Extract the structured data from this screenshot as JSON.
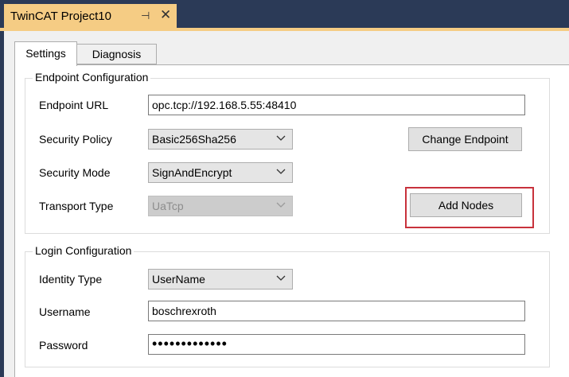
{
  "document_tab": {
    "title": "TwinCAT Project10",
    "pin_glyph": "⊣",
    "close_glyph": "✕"
  },
  "tabs": [
    {
      "label": "Settings",
      "active": true
    },
    {
      "label": "Diagnosis",
      "active": false
    }
  ],
  "endpoint": {
    "legend": "Endpoint Configuration",
    "url_label": "Endpoint URL",
    "url_value": "opc.tcp://192.168.5.55:48410",
    "policy_label": "Security Policy",
    "policy_value": "Basic256Sha256",
    "mode_label": "Security Mode",
    "mode_value": "SignAndEncrypt",
    "transport_label": "Transport Type",
    "transport_value": "UaTcp",
    "change_button": "Change Endpoint",
    "add_nodes_button": "Add Nodes"
  },
  "login": {
    "legend": "Login Configuration",
    "identity_label": "Identity Type",
    "identity_value": "UserName",
    "username_label": "Username",
    "username_value": "boschrexroth",
    "password_label": "Password",
    "password_value": "•••••••••••••"
  },
  "colors": {
    "accent": "#f5cc84",
    "highlight": "#c8323c",
    "frame": "#2b3a57"
  }
}
